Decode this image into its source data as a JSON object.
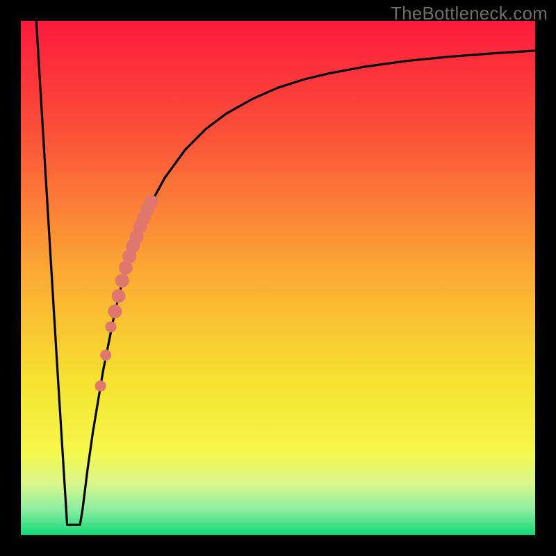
{
  "chart_data": {
    "type": "line",
    "title": "",
    "xlabel": "",
    "ylabel": "",
    "xlim": [
      0,
      100
    ],
    "ylim": [
      0,
      100
    ],
    "watermark": "TheBottleneck.com",
    "gradient_stops": [
      {
        "pos": 0.0,
        "color": "#fc1b3c"
      },
      {
        "pos": 0.22,
        "color": "#fb5139"
      },
      {
        "pos": 0.48,
        "color": "#fba733"
      },
      {
        "pos": 0.7,
        "color": "#f6e22f"
      },
      {
        "pos": 0.84,
        "color": "#f4f84b"
      },
      {
        "pos": 0.9,
        "color": "#d9f58d"
      },
      {
        "pos": 0.95,
        "color": "#8ceea0"
      },
      {
        "pos": 1.0,
        "color": "#12d877"
      }
    ],
    "curve": {
      "x": [
        3.0,
        5.0,
        7.0,
        8.5,
        9.0,
        10.0,
        11.5,
        12.0,
        13.0,
        14.0,
        16.0,
        18.0,
        20.0,
        22.0,
        25.0,
        28.0,
        32.0,
        36.0,
        40.0,
        45.0,
        50.0,
        55.0,
        60.0,
        67.0,
        75.0,
        83.0,
        92.0,
        100.0
      ],
      "y": [
        100.0,
        67.0,
        34.0,
        10.0,
        2.0,
        2.0,
        2.0,
        5.0,
        13.0,
        20.0,
        32.0,
        42.0,
        50.5,
        56.5,
        64.0,
        69.5,
        75.0,
        79.0,
        82.0,
        84.8,
        87.0,
        88.6,
        89.8,
        91.1,
        92.2,
        93.0,
        93.7,
        94.2
      ]
    },
    "markers": {
      "color": "#e0776e",
      "points": [
        {
          "x": 15.5,
          "y": 29.0,
          "r": 8
        },
        {
          "x": 16.5,
          "y": 35.0,
          "r": 8
        },
        {
          "x": 17.5,
          "y": 40.5,
          "r": 8
        },
        {
          "x": 18.3,
          "y": 43.5,
          "r": 10
        },
        {
          "x": 19.0,
          "y": 46.5,
          "r": 10
        },
        {
          "x": 19.7,
          "y": 49.5,
          "r": 10
        },
        {
          "x": 20.4,
          "y": 52.0,
          "r": 10
        },
        {
          "x": 21.1,
          "y": 54.2,
          "r": 10
        },
        {
          "x": 21.8,
          "y": 56.2,
          "r": 10
        },
        {
          "x": 22.5,
          "y": 58.0,
          "r": 10
        },
        {
          "x": 23.2,
          "y": 60.0,
          "r": 10
        },
        {
          "x": 23.9,
          "y": 61.7,
          "r": 10
        },
        {
          "x": 24.6,
          "y": 63.3,
          "r": 10
        },
        {
          "x": 25.3,
          "y": 64.8,
          "r": 10
        }
      ]
    }
  }
}
